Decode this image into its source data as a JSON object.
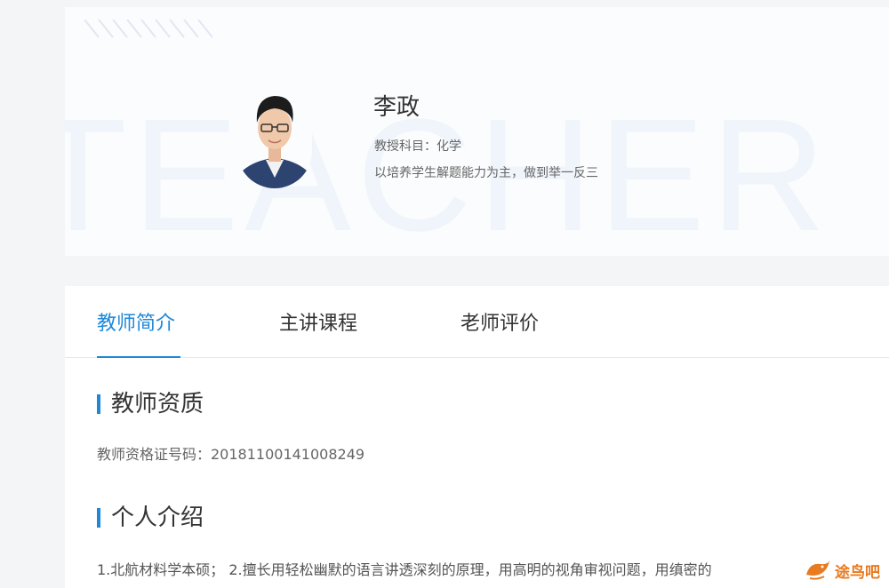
{
  "teacher": {
    "name": "李政",
    "subject": "教授科目：化学",
    "slogan": "以培养学生解题能力为主，做到举一反三",
    "watermark": "TEACHER"
  },
  "tabs": [
    {
      "label": "教师简介",
      "active": true
    },
    {
      "label": "主讲课程",
      "active": false
    },
    {
      "label": "老师评价",
      "active": false
    }
  ],
  "sections": {
    "qualification": {
      "title": "教师资质",
      "cert": "教师资格证号码：20181100141008249"
    },
    "intro": {
      "title": "个人介绍",
      "text": "1.北航材料学本硕； 2.擅长用轻松幽默的语言讲透深刻的原理，用高明的视角审视问题，用缜密的"
    }
  },
  "brand": {
    "name": "途鸟吧",
    "color": "#e87a1f"
  },
  "colors": {
    "accent": "#1e88d8",
    "text": "#333333",
    "muted": "#666666"
  }
}
